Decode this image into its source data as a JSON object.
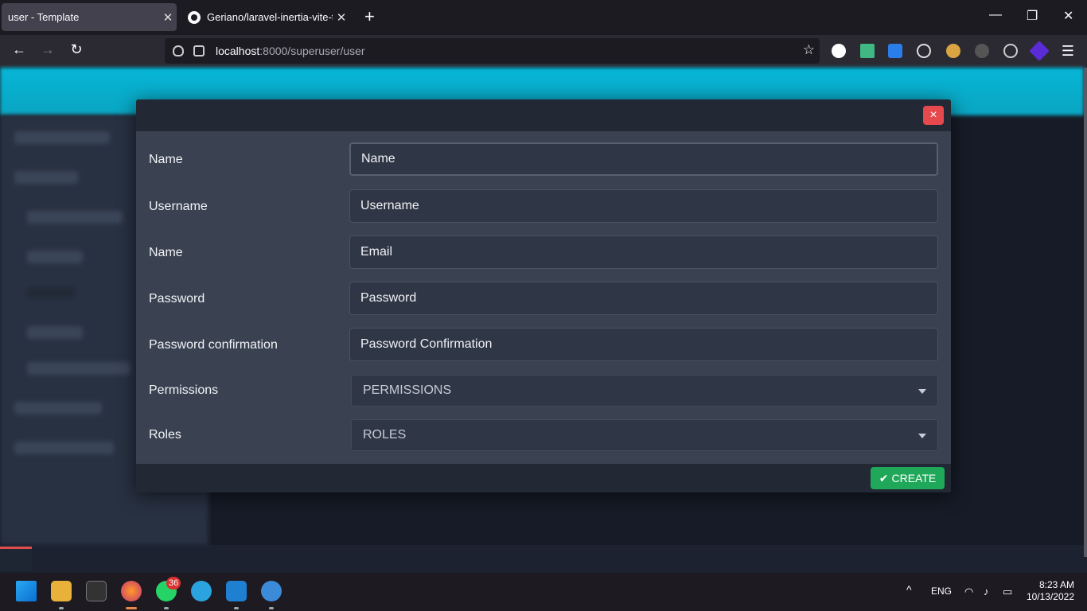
{
  "browser": {
    "tabs": [
      {
        "title": "user - Template",
        "active": true
      },
      {
        "title": "Geriano/laravel-inertia-vite-tem",
        "active": false
      }
    ],
    "url_host": "localhost",
    "url_rest": ":8000/superuser/user"
  },
  "modal": {
    "close_icon": "×",
    "fields": [
      {
        "label": "Name",
        "placeholder": "Name"
      },
      {
        "label": "Username",
        "placeholder": "Username"
      },
      {
        "label": "Name",
        "placeholder": "Email"
      },
      {
        "label": "Password",
        "placeholder": "Password"
      },
      {
        "label": "Password confirmation",
        "placeholder": "Password Confirmation"
      }
    ],
    "selects": [
      {
        "label": "Permissions",
        "value": "PERMISSIONS"
      },
      {
        "label": "Roles",
        "value": "ROLES"
      }
    ],
    "create_label": "CREATE",
    "create_icon": "check-icon"
  },
  "taskbar": {
    "whatsapp_badge": "36",
    "lang": "ENG",
    "time": "8:23 AM",
    "date": "10/13/2022"
  },
  "colors": {
    "header_accent": "#07b6d6",
    "close_button": "#e5484d",
    "create_button": "#1fa85a"
  }
}
